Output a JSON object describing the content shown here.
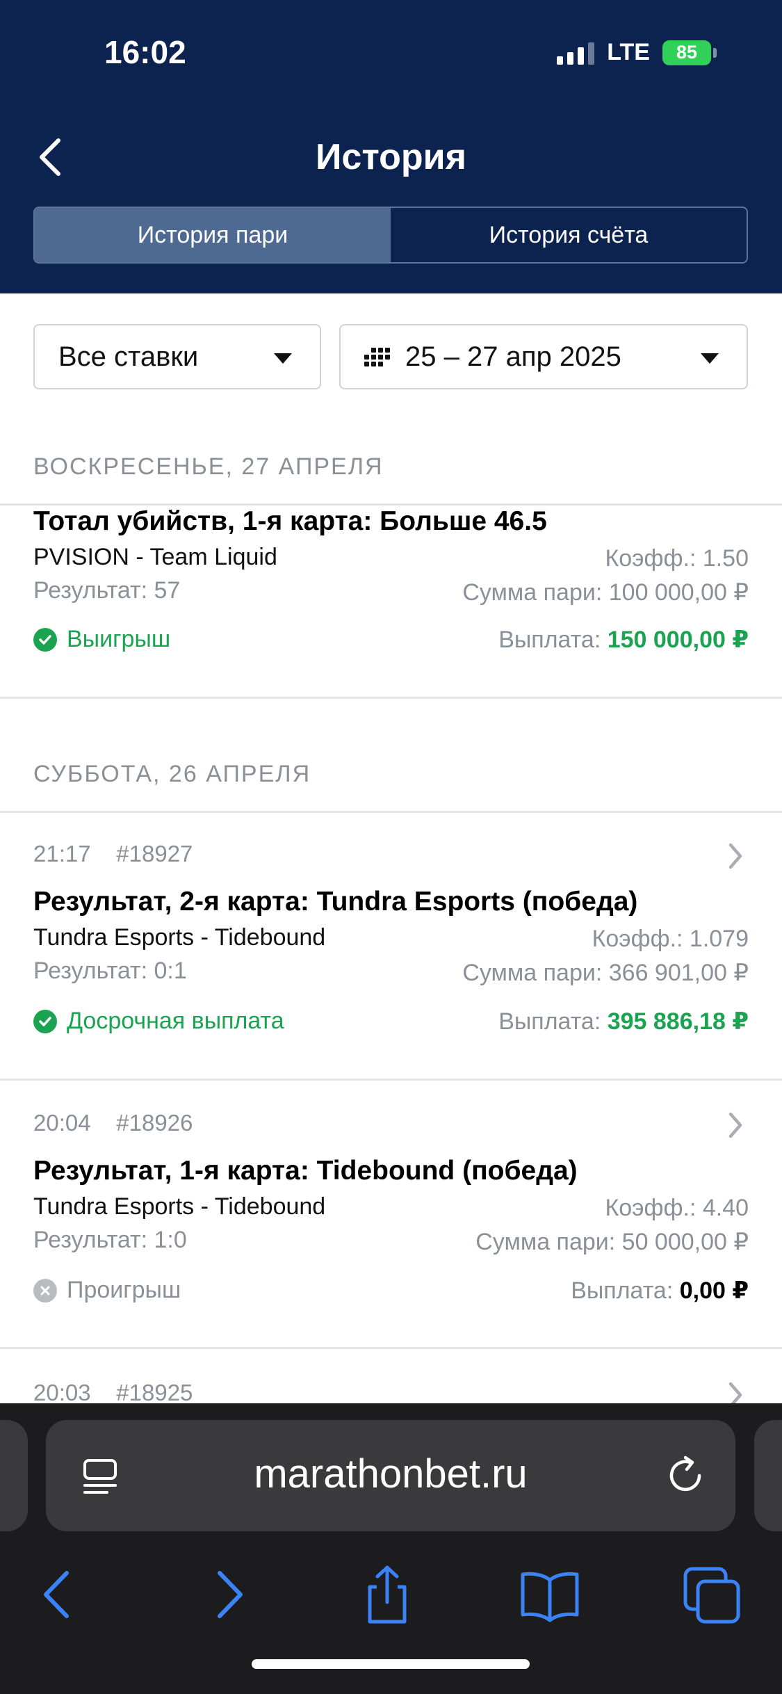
{
  "status_bar": {
    "time": "16:02",
    "network": "LTE",
    "battery": "85"
  },
  "header": {
    "title": "История",
    "tabs": [
      {
        "label": "История пари",
        "active": true
      },
      {
        "label": "История счёта",
        "active": false
      }
    ]
  },
  "filters": {
    "type": "Все ставки",
    "date_range": "25 – 27 апр 2025"
  },
  "days": [
    {
      "label": "ВОСКРЕСЕНЬЕ, 27 АПРЕЛЯ"
    },
    {
      "label": "СУББОТА, 26 АПРЕЛЯ"
    }
  ],
  "bets": [
    {
      "time": "",
      "id": "",
      "title": "Тотал убийств, 1-я карта: Больше 46.5",
      "match": "PVISION - Team Liquid",
      "result": "Результат: 57",
      "coef": "Коэфф.: 1.50",
      "sum": "Сумма пари: 100 000,00 ₽",
      "status": "Выигрыш",
      "status_type": "win",
      "payout_label": "Выплата:",
      "payout": "150 000,00 ₽"
    },
    {
      "time": "21:17",
      "id": "#18927",
      "title": "Результат, 2-я карта: Tundra Esports (победа)",
      "match": "Tundra Esports - Tidebound",
      "result": "Результат: 0:1",
      "coef": "Коэфф.: 1.079",
      "sum": "Сумма пари: 366 901,00 ₽",
      "status": "Досрочная выплата",
      "status_type": "win",
      "payout_label": "Выплата:",
      "payout": "395 886,18 ₽"
    },
    {
      "time": "20:04",
      "id": "#18926",
      "title": "Результат, 1-я карта: Tidebound (победа)",
      "match": "Tundra Esports - Tidebound",
      "result": "Результат: 1:0",
      "coef": "Коэфф.: 4.40",
      "sum": "Сумма пари: 50 000,00 ₽",
      "status": "Проигрыш",
      "status_type": "lose",
      "payout_label": "Выплата:",
      "payout": "0,00 ₽"
    },
    {
      "time": "20:03",
      "id": "#18925"
    }
  ],
  "browser": {
    "url": "marathonbet.ru"
  },
  "colors": {
    "header_bg": "#0c2350",
    "win_green": "#1ba351",
    "muted": "#8a9097"
  }
}
